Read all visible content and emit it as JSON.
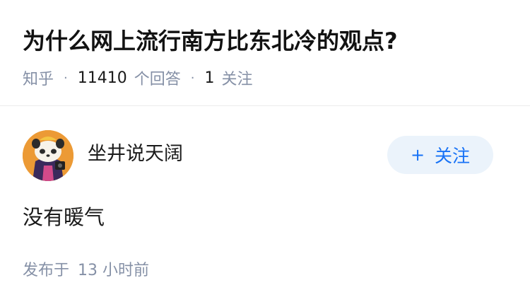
{
  "question": {
    "title": "为什么网上流行南方比东北冷的观点?",
    "source": "知乎",
    "answer_count": "11410",
    "answer_label": "个回答",
    "follow_count": "1",
    "follow_label": "关注"
  },
  "answer": {
    "author_name": "坐井说天阔",
    "follow_button": {
      "icon": "plus-icon",
      "plus": "+",
      "label": "关注"
    },
    "content": "没有暖气",
    "posted_label": "发布于",
    "posted_time": "13 小时前"
  },
  "colors": {
    "muted_text": "#8590a6",
    "accent": "#1772f6",
    "button_bg": "#ebf3fb"
  }
}
